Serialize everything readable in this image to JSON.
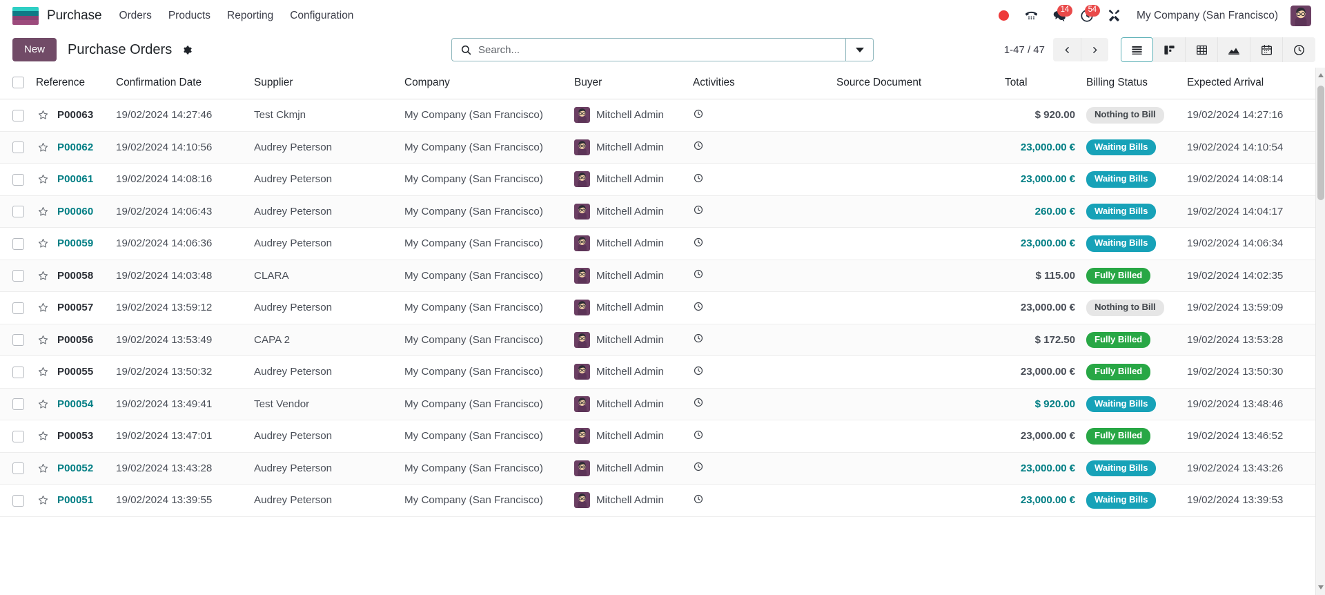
{
  "navbar": {
    "app_name": "Purchase",
    "logo_icon": "odoo-logo",
    "menu": [
      {
        "label": "Orders"
      },
      {
        "label": "Products"
      },
      {
        "label": "Reporting"
      },
      {
        "label": "Configuration"
      }
    ],
    "status_icons": [
      {
        "name": "recording-dot-icon",
        "badge": ""
      },
      {
        "name": "phone-voip-icon",
        "badge": ""
      },
      {
        "name": "messages-chat-icon",
        "badge": "14"
      },
      {
        "name": "activities-clock-icon",
        "badge": "54"
      },
      {
        "name": "tools-wrench-icon",
        "badge": ""
      }
    ],
    "company": "My Company (San Francisco)",
    "avatar_icon": "user-avatar"
  },
  "control_panel": {
    "new_label": "New",
    "title": "Purchase Orders",
    "settings_icon": "gear-icon",
    "search": {
      "placeholder": "Search...",
      "value": "",
      "icon": "search-icon",
      "dropdown_icon": "chevron-down-icon"
    },
    "pager": {
      "count": "1-47 / 47",
      "prev_icon": "chevron-left-icon",
      "next_icon": "chevron-right-icon"
    },
    "views": [
      {
        "name": "list-view",
        "icon": "list-icon",
        "active": true
      },
      {
        "name": "kanban-view",
        "icon": "kanban-icon",
        "active": false
      },
      {
        "name": "pivot-view",
        "icon": "pivot-table-icon",
        "active": false
      },
      {
        "name": "graph-view",
        "icon": "area-chart-icon",
        "active": false
      },
      {
        "name": "calendar-view",
        "icon": "calendar-icon",
        "active": false
      },
      {
        "name": "activity-view",
        "icon": "clock-icon",
        "active": false
      }
    ]
  },
  "table": {
    "columns": [
      {
        "key": "reference",
        "label": "Reference"
      },
      {
        "key": "confirmation_date",
        "label": "Confirmation Date"
      },
      {
        "key": "supplier",
        "label": "Supplier"
      },
      {
        "key": "company",
        "label": "Company"
      },
      {
        "key": "buyer",
        "label": "Buyer"
      },
      {
        "key": "activities",
        "label": "Activities"
      },
      {
        "key": "source_document",
        "label": "Source Document"
      },
      {
        "key": "total",
        "label": "Total"
      },
      {
        "key": "billing_status",
        "label": "Billing Status"
      },
      {
        "key": "expected_arrival",
        "label": "Expected Arrival"
      }
    ],
    "optional_columns_icon": "column-options-icon",
    "select_all_checkbox": false,
    "rows": [
      {
        "reference": "P00063",
        "confirmation_date": "19/02/2024 14:27:46",
        "supplier": "Test Ckmjn",
        "company": "My Company (San Francisco)",
        "buyer": "Mitchell Admin",
        "source_document": "",
        "total": "$ 920.00",
        "billing_status": "Nothing to Bill",
        "billing_style": "muted",
        "expected_arrival": "19/02/2024 14:27:16",
        "link_style": false
      },
      {
        "reference": "P00062",
        "confirmation_date": "19/02/2024 14:10:56",
        "supplier": "Audrey Peterson",
        "company": "My Company (San Francisco)",
        "buyer": "Mitchell Admin",
        "source_document": "",
        "total": "23,000.00 €",
        "billing_status": "Waiting Bills",
        "billing_style": "info",
        "expected_arrival": "19/02/2024 14:10:54",
        "link_style": true
      },
      {
        "reference": "P00061",
        "confirmation_date": "19/02/2024 14:08:16",
        "supplier": "Audrey Peterson",
        "company": "My Company (San Francisco)",
        "buyer": "Mitchell Admin",
        "source_document": "",
        "total": "23,000.00 €",
        "billing_status": "Waiting Bills",
        "billing_style": "info",
        "expected_arrival": "19/02/2024 14:08:14",
        "link_style": true
      },
      {
        "reference": "P00060",
        "confirmation_date": "19/02/2024 14:06:43",
        "supplier": "Audrey Peterson",
        "company": "My Company (San Francisco)",
        "buyer": "Mitchell Admin",
        "source_document": "",
        "total": "260.00 €",
        "billing_status": "Waiting Bills",
        "billing_style": "info",
        "expected_arrival": "19/02/2024 14:04:17",
        "link_style": true
      },
      {
        "reference": "P00059",
        "confirmation_date": "19/02/2024 14:06:36",
        "supplier": "Audrey Peterson",
        "company": "My Company (San Francisco)",
        "buyer": "Mitchell Admin",
        "source_document": "",
        "total": "23,000.00 €",
        "billing_status": "Waiting Bills",
        "billing_style": "info",
        "expected_arrival": "19/02/2024 14:06:34",
        "link_style": true
      },
      {
        "reference": "P00058",
        "confirmation_date": "19/02/2024 14:03:48",
        "supplier": "CLARA",
        "company": "My Company (San Francisco)",
        "buyer": "Mitchell Admin",
        "source_document": "",
        "total": "$ 115.00",
        "billing_status": "Fully Billed",
        "billing_style": "success",
        "expected_arrival": "19/02/2024 14:02:35",
        "link_style": false
      },
      {
        "reference": "P00057",
        "confirmation_date": "19/02/2024 13:59:12",
        "supplier": "Audrey Peterson",
        "company": "My Company (San Francisco)",
        "buyer": "Mitchell Admin",
        "source_document": "",
        "total": "23,000.00 €",
        "billing_status": "Nothing to Bill",
        "billing_style": "muted",
        "expected_arrival": "19/02/2024 13:59:09",
        "link_style": false
      },
      {
        "reference": "P00056",
        "confirmation_date": "19/02/2024 13:53:49",
        "supplier": "CAPA 2",
        "company": "My Company (San Francisco)",
        "buyer": "Mitchell Admin",
        "source_document": "",
        "total": "$ 172.50",
        "billing_status": "Fully Billed",
        "billing_style": "success",
        "expected_arrival": "19/02/2024 13:53:28",
        "link_style": false
      },
      {
        "reference": "P00055",
        "confirmation_date": "19/02/2024 13:50:32",
        "supplier": "Audrey Peterson",
        "company": "My Company (San Francisco)",
        "buyer": "Mitchell Admin",
        "source_document": "",
        "total": "23,000.00 €",
        "billing_status": "Fully Billed",
        "billing_style": "success",
        "expected_arrival": "19/02/2024 13:50:30",
        "link_style": false
      },
      {
        "reference": "P00054",
        "confirmation_date": "19/02/2024 13:49:41",
        "supplier": "Test Vendor",
        "company": "My Company (San Francisco)",
        "buyer": "Mitchell Admin",
        "source_document": "",
        "total": "$ 920.00",
        "billing_status": "Waiting Bills",
        "billing_style": "info",
        "expected_arrival": "19/02/2024 13:48:46",
        "link_style": true
      },
      {
        "reference": "P00053",
        "confirmation_date": "19/02/2024 13:47:01",
        "supplier": "Audrey Peterson",
        "company": "My Company (San Francisco)",
        "buyer": "Mitchell Admin",
        "source_document": "",
        "total": "23,000.00 €",
        "billing_status": "Fully Billed",
        "billing_style": "success",
        "expected_arrival": "19/02/2024 13:46:52",
        "link_style": false
      },
      {
        "reference": "P00052",
        "confirmation_date": "19/02/2024 13:43:28",
        "supplier": "Audrey Peterson",
        "company": "My Company (San Francisco)",
        "buyer": "Mitchell Admin",
        "source_document": "",
        "total": "23,000.00 €",
        "billing_status": "Waiting Bills",
        "billing_style": "info",
        "expected_arrival": "19/02/2024 13:43:26",
        "link_style": true
      },
      {
        "reference": "P00051",
        "confirmation_date": "19/02/2024 13:39:55",
        "supplier": "Audrey Peterson",
        "company": "My Company (San Francisco)",
        "buyer": "Mitchell Admin",
        "source_document": "",
        "total": "23,000.00 €",
        "billing_status": "Waiting Bills",
        "billing_style": "info",
        "expected_arrival": "19/02/2024 13:39:53",
        "link_style": true
      }
    ]
  },
  "colors": {
    "brand_purple": "#714b67",
    "link_teal": "#017e84",
    "badge_info": "#17a2b8",
    "badge_success": "#28a745",
    "badge_muted": "#e6e6e6",
    "notification_red": "#e94a4a"
  }
}
